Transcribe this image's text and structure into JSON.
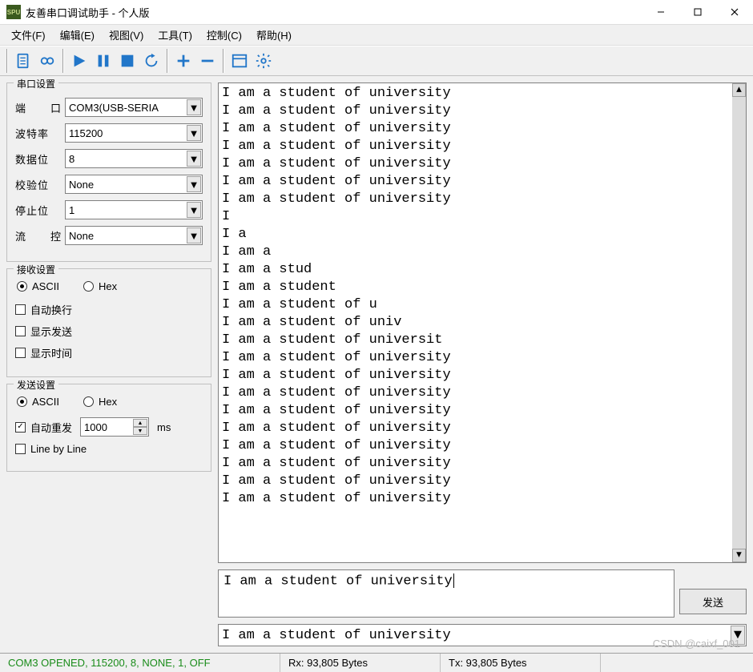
{
  "title": "友善串口调试助手 - 个人版",
  "menus": [
    "文件(F)",
    "编辑(E)",
    "视图(V)",
    "工具(T)",
    "控制(C)",
    "帮助(H)"
  ],
  "serial_settings": {
    "legend": "串口设置",
    "port": {
      "label_a": "端",
      "label_b": "口",
      "value": "COM3(USB-SERIA"
    },
    "baud": {
      "label": "波特率",
      "value": "115200"
    },
    "databits": {
      "label": "数据位",
      "value": "8"
    },
    "parity": {
      "label": "校验位",
      "value": "None"
    },
    "stopbits": {
      "label": "停止位",
      "value": "1"
    },
    "flow": {
      "label_a": "流",
      "label_b": "控",
      "value": "None"
    }
  },
  "recv_settings": {
    "legend": "接收设置",
    "ascii": "ASCII",
    "hex": "Hex",
    "auto_wrap": "自动换行",
    "show_send": "显示发送",
    "show_time": "显示时间"
  },
  "send_settings": {
    "legend": "发送设置",
    "ascii": "ASCII",
    "hex": "Hex",
    "auto_resend": "自动重发",
    "resend_interval": "1000",
    "resend_unit": "ms",
    "line_by_line": "Line by Line"
  },
  "output_lines": [
    "I am a student of university",
    "I am a student of university",
    "I am a student of university",
    "I am a student of university",
    "I am a student of university",
    "I am a student of university",
    "I am a student of university",
    "I",
    "I a",
    "I am a",
    "I am a stud",
    "I am a student",
    "I am a student of u",
    "I am a student of univ",
    "I am a student of universit",
    "I am a student of university",
    "I am a student of university",
    "I am a student of university",
    "I am a student of university",
    "I am a student of university",
    "I am a student of university",
    "I am a student of university",
    "I am a student of university",
    "I am a student of university"
  ],
  "input_text": "I am a student of university",
  "send_button": "发送",
  "history_value": "I am a student of university",
  "status": {
    "conn": "COM3 OPENED, 115200, 8, NONE, 1, OFF",
    "rx": "Rx: 93,805 Bytes",
    "tx": "Tx: 93,805 Bytes"
  },
  "watermark": "CSDN @caixf_001"
}
